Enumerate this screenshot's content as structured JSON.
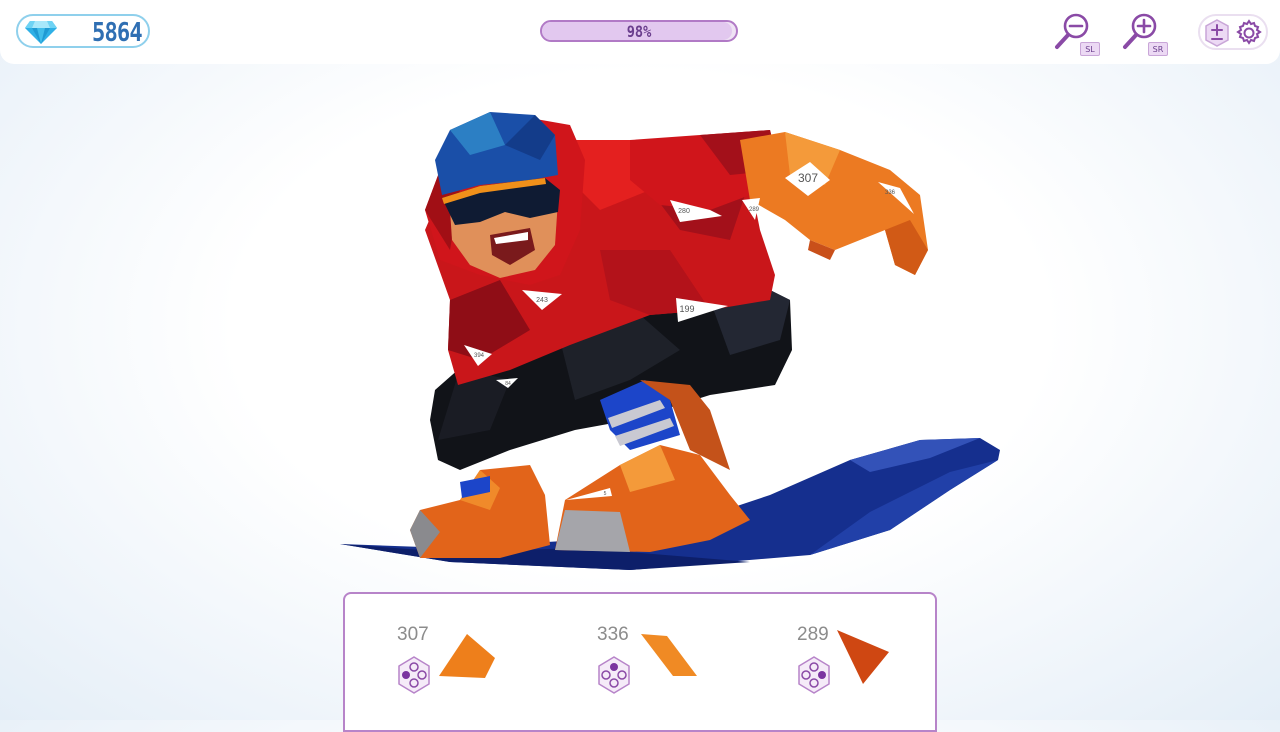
{
  "hud": {
    "gems": "5864",
    "progress_label": "98%",
    "progress_fraction": 0.98,
    "zoom_out_tag": "SL",
    "zoom_in_tag": "SR",
    "colors": {
      "gem": "#35b6e6",
      "accent": "#b17ac6",
      "progress_text": "#6b3f8e"
    }
  },
  "board_labels": [
    "307",
    "336",
    "289",
    "280",
    "243",
    "199",
    "394",
    "84",
    "5"
  ],
  "pieces": [
    {
      "number": "307",
      "color": "#ee7f1b",
      "dots_active": [
        "left",
        "bottom"
      ],
      "icon": "dot-pad-icon"
    },
    {
      "number": "336",
      "color": "#f08a24",
      "dots_active": [
        "top"
      ],
      "icon": "dot-pad-icon"
    },
    {
      "number": "289",
      "color": "#cf4712",
      "dots_active": [
        "right"
      ],
      "icon": "dot-pad-icon"
    }
  ],
  "icons": {
    "gem": "diamond-icon",
    "zoom_out": "zoom-out-icon",
    "zoom_in": "zoom-in-icon",
    "plus_minus": "plus-minus-icon",
    "settings": "gear-icon"
  }
}
